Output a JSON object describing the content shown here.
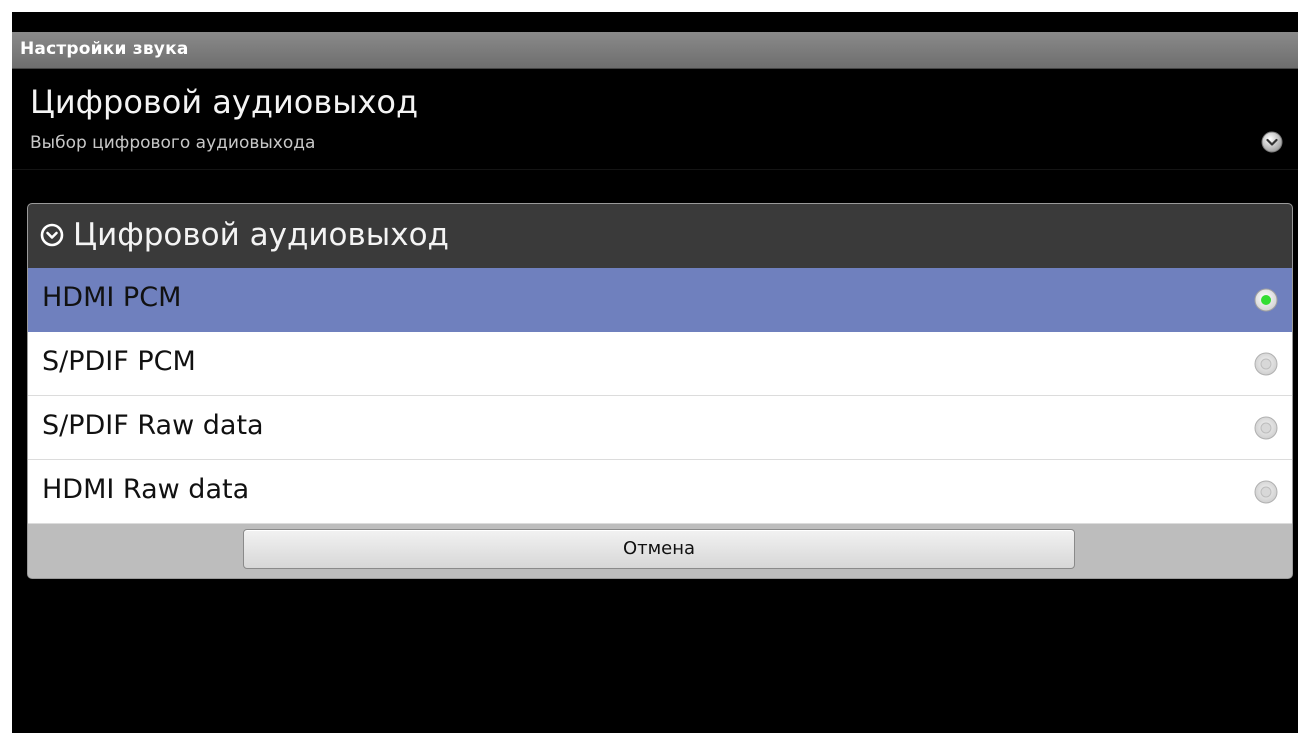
{
  "titlebar": {
    "title": "Настройки звука"
  },
  "preference": {
    "title": "Цифровой аудиовыход",
    "summary": "Выбор цифрового аудиовыхода",
    "icon": "chevron-down-circle-icon"
  },
  "dialog": {
    "title": "Цифровой аудиовыход",
    "header_icon": "chevron-down-circle-icon",
    "options": [
      {
        "label": "HDMI PCM",
        "selected": true
      },
      {
        "label": "S/PDIF PCM",
        "selected": false
      },
      {
        "label": "S/PDIF Raw data",
        "selected": false
      },
      {
        "label": "HDMI Raw data",
        "selected": false
      }
    ],
    "cancel_label": "Отмена"
  },
  "colors": {
    "selected_row": "#6f80be",
    "radio_selected": "#33dd33",
    "title_bar": "#7a7a7a",
    "dialog_header": "#3a3a3a"
  }
}
